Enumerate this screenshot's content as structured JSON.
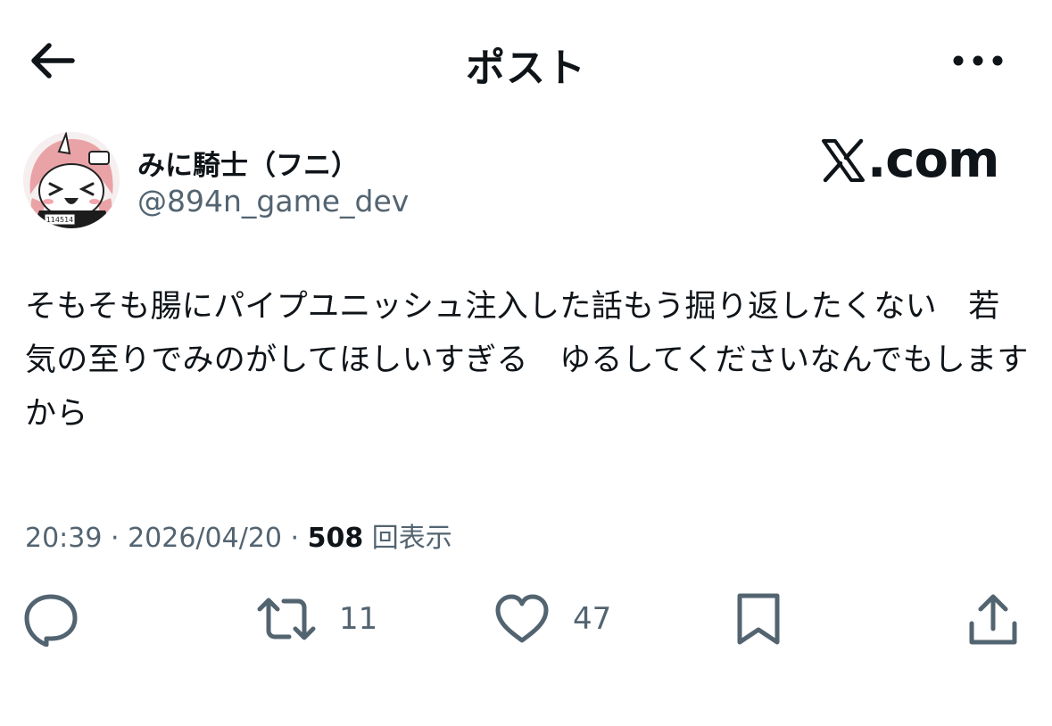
{
  "header": {
    "title": "ポスト",
    "back_icon": "arrow-left-icon",
    "more_icon": "ellipsis-icon"
  },
  "author": {
    "display_name": "みに騎士（フニ）",
    "handle": "@894n_game_dev",
    "avatar_text": "114514"
  },
  "watermark": {
    "text": ".com"
  },
  "post": {
    "text": "そもそも腸にパイプユニッシュ注入した話もう掘り返したくない　若気の至りでみのがしてほしいすぎる　ゆるしてくださいなんでもしますから",
    "time": "20:39",
    "date": "2026/04/20",
    "separator": " · ",
    "views": "508",
    "views_label": "回表示"
  },
  "actions": {
    "reply_icon": "reply-icon",
    "retweet_icon": "retweet-icon",
    "retweets": "11",
    "like_icon": "heart-icon",
    "likes": "47",
    "bookmark_icon": "bookmark-icon",
    "share_icon": "share-icon"
  },
  "colors": {
    "text": "#0f1419",
    "secondary": "#536471",
    "background": "#ffffff"
  }
}
